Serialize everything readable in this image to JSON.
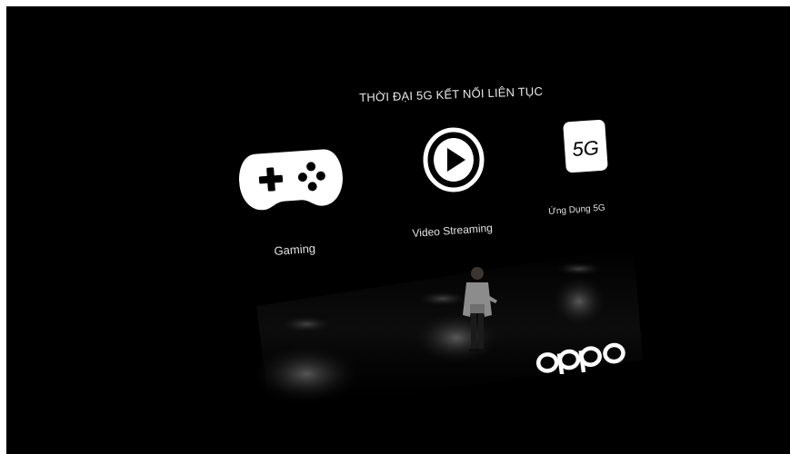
{
  "headline": "THỜI ĐẠI 5G KẾT NỐI LIÊN TỤC",
  "features": [
    {
      "icon": "gamepad-icon",
      "label": "Gaming"
    },
    {
      "icon": "play-icon",
      "label": "Video Streaming"
    },
    {
      "icon": "5g-icon",
      "badge_text": "5G",
      "label": "Ứng Dụng 5G"
    }
  ],
  "brand": "oppo",
  "colors": {
    "background": "#000000",
    "foreground": "#ffffff",
    "frame_border": "#ffffff"
  }
}
